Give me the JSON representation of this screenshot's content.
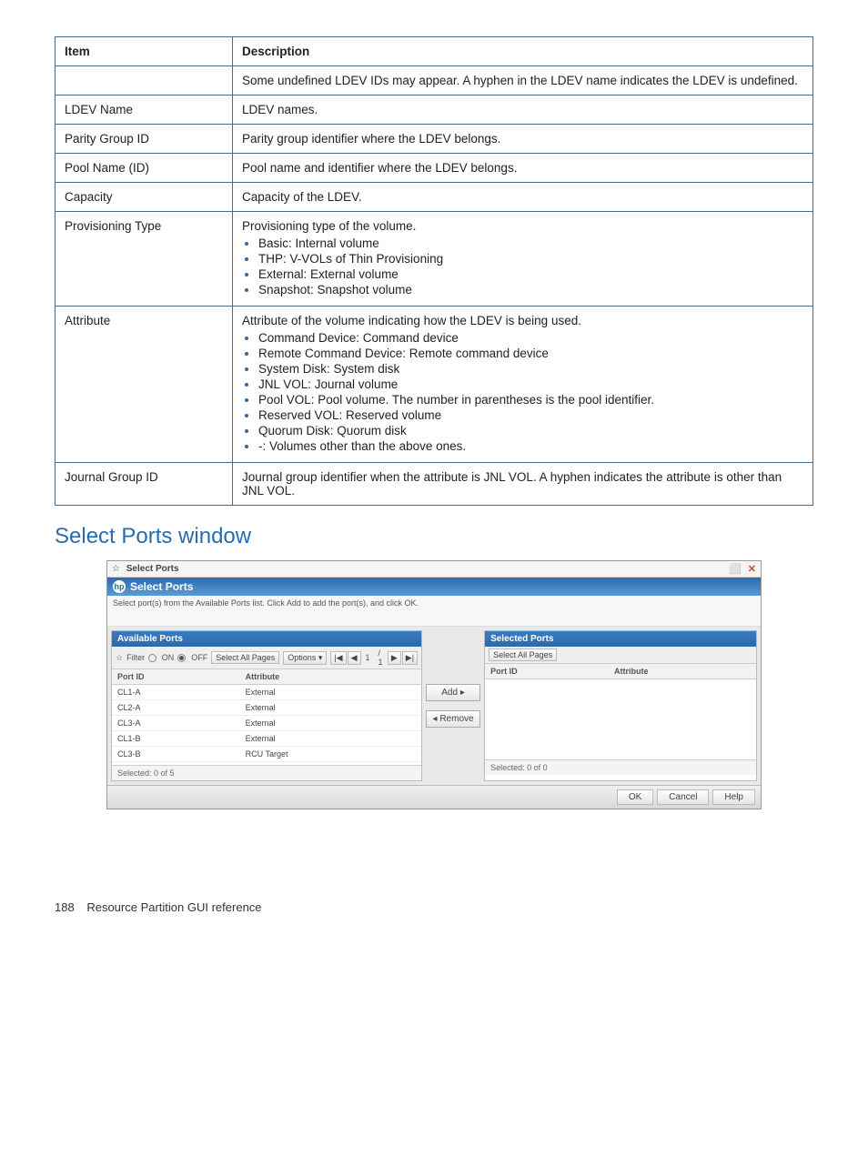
{
  "table": {
    "headers": {
      "item": "Item",
      "desc": "Description"
    },
    "rows": [
      {
        "item": "",
        "desc_text": "Some undefined LDEV IDs may appear. A hyphen in the LDEV name indicates the LDEV is undefined."
      },
      {
        "item": "LDEV Name",
        "desc_text": "LDEV names."
      },
      {
        "item": "Parity Group ID",
        "desc_text": "Parity group identifier where the LDEV belongs."
      },
      {
        "item": "Pool Name (ID)",
        "desc_text": "Pool name and identifier where the LDEV belongs."
      },
      {
        "item": "Capacity",
        "desc_text": "Capacity of the LDEV."
      },
      {
        "item": "Provisioning Type",
        "desc_text": "Provisioning type of the volume.",
        "bullets": [
          "Basic: Internal volume",
          "THP: V-VOLs of Thin Provisioning",
          "External: External volume",
          "Snapshot: Snapshot volume"
        ]
      },
      {
        "item": "Attribute",
        "desc_text": "Attribute of the volume indicating how the LDEV is being used.",
        "bullets": [
          "Command Device: Command device",
          "Remote Command Device: Remote command device",
          "System Disk: System disk",
          "JNL VOL: Journal volume",
          "Pool VOL: Pool volume. The number in parentheses is the pool identifier.",
          "Reserved VOL: Reserved volume",
          "Quorum Disk: Quorum disk",
          "-: Volumes other than the above ones."
        ]
      },
      {
        "item": "Journal Group ID",
        "desc_text": "Journal group identifier when the attribute is JNL VOL. A hyphen indicates the attribute is other than JNL VOL."
      }
    ]
  },
  "section_heading": "Select Ports window",
  "screenshot": {
    "titlebar": {
      "collapse": "☆",
      "title": "Select Ports",
      "max_icon": "⬜",
      "close_icon": "✕"
    },
    "header": {
      "logo": "hp",
      "title": "Select Ports"
    },
    "instruction": "Select port(s) from the Available Ports list. Click Add to add the port(s), and click OK.",
    "available": {
      "title": "Available Ports",
      "toolbar": {
        "filter_label": "Filter",
        "on": "ON",
        "off": "OFF",
        "select_all": "Select All Pages",
        "options": "Options ▾",
        "page_current": "1",
        "page_total": "/ 1",
        "first": "|◀",
        "prev": "◀",
        "next": "▶",
        "last": "▶|"
      },
      "cols": {
        "port": "Port ID",
        "attr": "Attribute"
      },
      "rows": [
        {
          "port": "CL1-A",
          "attr": "External"
        },
        {
          "port": "CL2-A",
          "attr": "External"
        },
        {
          "port": "CL3-A",
          "attr": "External"
        },
        {
          "port": "CL1-B",
          "attr": "External"
        },
        {
          "port": "CL3-B",
          "attr": "RCU Target"
        }
      ],
      "footer": "Selected:  0   of  5"
    },
    "mid": {
      "add": "Add ▸",
      "remove": "◂ Remove"
    },
    "selected": {
      "title": "Selected Ports",
      "toolbar": {
        "select_all": "Select All Pages"
      },
      "cols": {
        "port": "Port ID",
        "attr": "Attribute"
      },
      "footer": "Selected:  0   of  0"
    },
    "footer_btns": {
      "ok": "OK",
      "cancel": "Cancel",
      "help": "Help"
    }
  },
  "page_footer": {
    "num": "188",
    "text": "Resource Partition GUI reference"
  }
}
